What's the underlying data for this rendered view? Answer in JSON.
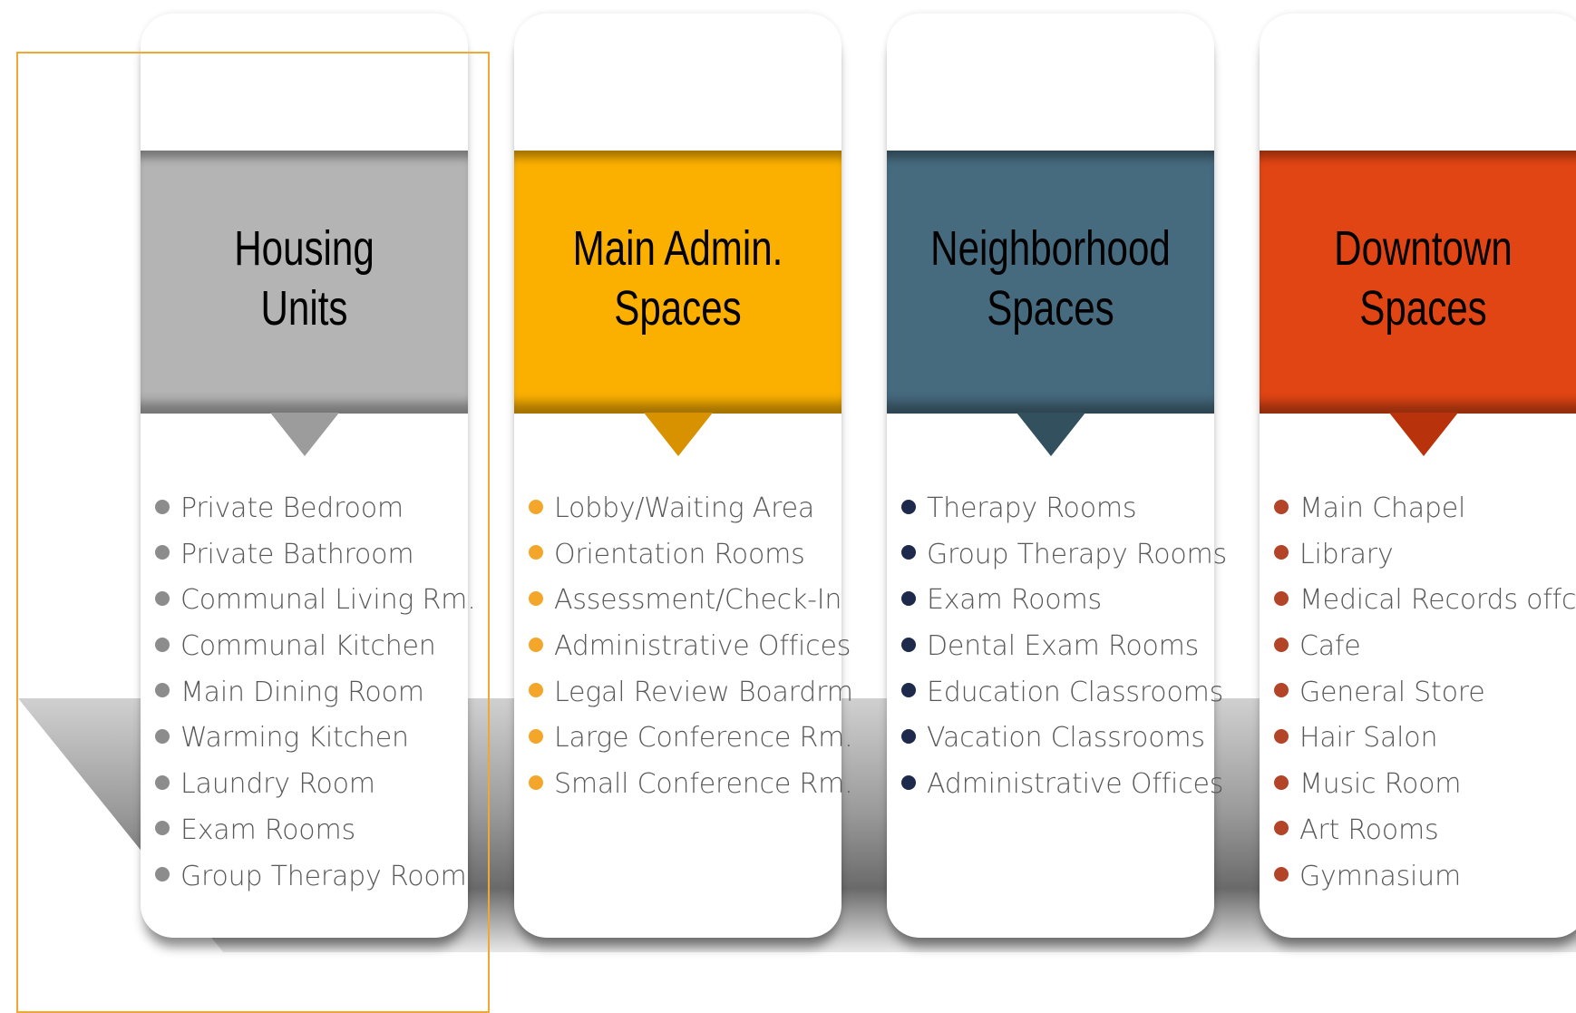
{
  "columns": [
    {
      "title": "Housing\nUnits",
      "color": "#b4b4b4",
      "pointer_color": "#9c9c9c",
      "bullet_color": "#8c8c8c",
      "items": [
        "Private Bedroom",
        "Private Bathroom",
        "Communal Living Rm.",
        "Communal Kitchen",
        "Main Dining Room",
        "Warming Kitchen",
        "Laundry Room",
        "Exam Rooms",
        "Group Therapy Room"
      ]
    },
    {
      "title": "Main Admin.\nSpaces",
      "color": "#fbb000",
      "pointer_color": "#d89200",
      "bullet_color": "#f4a62a",
      "items": [
        "Lobby/Waiting Area",
        "Orientation Rooms",
        "Assessment/Check-In",
        "Administrative Offices",
        "Legal Review Boardrm",
        "Large Conference Rm.",
        "Small Conference Rm."
      ]
    },
    {
      "title": "Neighborhood\nSpaces",
      "color": "#466a7e",
      "pointer_color": "#33505f",
      "bullet_color": "#1e2a4c",
      "items": [
        "Therapy Rooms",
        "Group Therapy Rooms",
        "Exam Rooms",
        "Dental Exam Rooms",
        "Education Classrooms",
        "Vacation Classrooms",
        "Administrative Offices"
      ]
    },
    {
      "title": "Downtown\nSpaces",
      "color": "#e24514",
      "pointer_color": "#b8330c",
      "bullet_color": "#b44428",
      "items": [
        "Main Chapel",
        "Library",
        "Medical Records offc.",
        "Cafe",
        "General Store",
        "Hair Salon",
        "Music Room",
        "Art Rooms",
        "Gymnasium"
      ]
    }
  ],
  "selection_color": "#f0a830"
}
